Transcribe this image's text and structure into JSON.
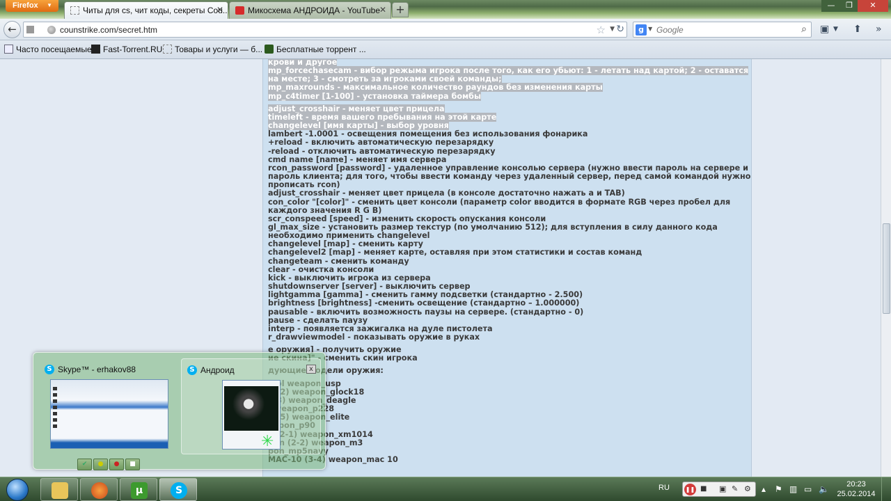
{
  "browser": {
    "menu_button": "Firefox",
    "tabs": [
      {
        "label": "Читы для cs, чит коды, секреты Cou...",
        "active": true
      },
      {
        "label": "Микосхема АНДРОИДА - YouTube",
        "active": false
      }
    ],
    "new_tab": "+",
    "window_controls": [
      "—",
      "❐",
      "✕"
    ],
    "url": "counstrike.com/secret.htm",
    "search_placeholder": "Google",
    "bookmarks": [
      {
        "label": "Часто посещаемые"
      },
      {
        "label": "Fast-Torrent.RU"
      },
      {
        "label": "Товары и услуги — б..."
      },
      {
        "label": "Бесплатные торрент ..."
      }
    ]
  },
  "content": {
    "lines": [
      {
        "text": "крови и другое",
        "selected": true
      },
      {
        "text": "mp_forcechasecam - вибор режыма игрока после того, как его убьют: 1 - летать над картой; 2 - оставатся",
        "selected": true
      },
      {
        "text": "на месте; 3 - смотреть за игроками своей команды;",
        "selected": true
      },
      {
        "text": "mp_maxrounds - максимальное количество раундов без изменения карты",
        "selected": true
      },
      {
        "text": "mp_c4timer [1-100] - установка таймера бомбы",
        "selected": true
      },
      {
        "text": "",
        "gap": true
      },
      {
        "text": "adjust_crosshair - меняет цвет прицела",
        "selected": true
      },
      {
        "text": "timeleft - время вашего пребывания на этой карте",
        "selected": true
      },
      {
        "text": "changelevel [имя карты] - выбор уровня",
        "selected": true
      },
      {
        "text": "lambert -1.0001 - освещения помещения без использования фонарика",
        "selected": false
      },
      {
        "text": "+reload - включить автоматическую перезарядку",
        "selected": false
      },
      {
        "text": "-reload - отключить автоматическую перезарядку",
        "selected": false
      },
      {
        "text": "cmd name [name] - меняет имя сервера",
        "selected": false
      },
      {
        "text": "rcon_password [password] - удаленное управление консолью сервера (нужно ввести пароль на сервере и",
        "selected": false
      },
      {
        "text": "пароль клиента; для того, чтобы ввести команду через удаленный сервер, перед самой командой нужно",
        "selected": false
      },
      {
        "text": "прописать rcon)",
        "selected": false
      },
      {
        "text": "adjust_crosshair - меняет цвет прицела (в консоле достаточно нажать a и TAB)",
        "selected": false
      },
      {
        "text": "con_color \"[color]\" - сменить цвет консоли (параметр color вводится в формате RGB через пробел для",
        "selected": false
      },
      {
        "text": "каждого значения R G B)",
        "selected": false
      },
      {
        "text": "scr_conspeed [speed] - изменить скорость опускания консоли",
        "selected": false
      },
      {
        "text": "gl_max_size - установить размер текстур (по умолчанию 512); для вступления в силу данного кода",
        "selected": false
      },
      {
        "text": "необходимо применить changelevel",
        "selected": false
      },
      {
        "text": "changelevel [map] - сменить карту",
        "selected": false
      },
      {
        "text": "changelevel2 [map] - меняет карте, оставляя при этом статистики и состав команд",
        "selected": false
      },
      {
        "text": "changeteam - сменить команду",
        "selected": false
      },
      {
        "text": "clear - очистка консоли",
        "selected": false
      },
      {
        "text": "kick - выключить игрока из сервера",
        "selected": false
      },
      {
        "text": "shutdownserver [server] - выключить сервер",
        "selected": false
      },
      {
        "text": "lightgamma [gamma] - сменить гамму подсветки (стандартно - 2.500)",
        "selected": false
      },
      {
        "text": "brightness [brightness] -сменить освещение (стандартно – 1.000000)",
        "selected": false
      },
      {
        "text": "pausable - включить возможность паузы на сервере. (стандартно - 0)",
        "selected": false
      },
      {
        "text": "pause - сделать паузу",
        "selected": false
      },
      {
        "text": "interp - появляется зажигалка на дуле пистолета",
        "selected": false
      },
      {
        "text": "r_drawviewmodel - показывать оружие в руках",
        "selected": false
      },
      {
        "text": "",
        "gap": true
      },
      {
        "text": "                    е оружия] - получить оружие",
        "selected": false
      },
      {
        "text": "                  ие скина]\" - сменить скин игрока",
        "selected": false
      },
      {
        "text": "",
        "gap": true
      },
      {
        "text": "                  дующие модели оружия:",
        "selected": false
      },
      {
        "text": "",
        "gap": true
      },
      {
        "text": "                  stol weapon_usp",
        "selected": false
      },
      {
        "text": "                   (1-2) weapon_glock18",
        "selected": false
      },
      {
        "text": "                  1-3) weapon_deagle",
        "selected": false
      },
      {
        "text": "                  ) weapon_p228",
        "selected": false
      },
      {
        "text": "                  (1-5) weapon_elite",
        "selected": false
      },
      {
        "text": "                  eapon_p90",
        "selected": false
      },
      {
        "text": "                  4 (2-1) weapon_xm1014",
        "selected": false
      },
      {
        "text": "                  gun (2-2) weapon_m3",
        "selected": false
      },
      {
        "text": "                  pon_mp5navy",
        "selected": false
      },
      {
        "text": "MAC-10 (3-4) weapon_mac 10",
        "selected": false
      }
    ]
  },
  "preview": {
    "skype_title": "Skype™ - erhakov88",
    "android_title": "Андроид",
    "close": "x"
  },
  "taskbar": {
    "language": "RU",
    "time": "20:23",
    "date": "25.02.2014"
  },
  "colors": {
    "selection": "#b4b8be",
    "page_bg": "#cde0f0",
    "text": "#3a3a3a"
  }
}
